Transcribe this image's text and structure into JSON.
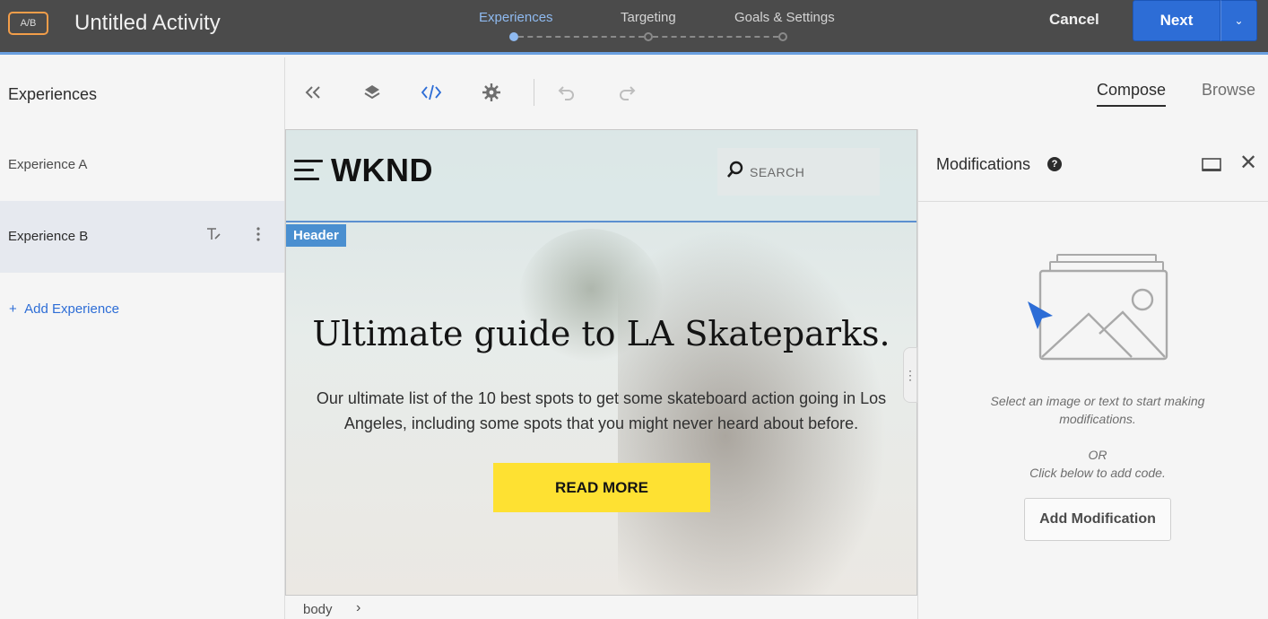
{
  "app": {
    "badge": "A/B",
    "title": "Untitled Activity"
  },
  "steps": [
    {
      "label": "Experiences"
    },
    {
      "label": "Targeting"
    },
    {
      "label": "Goals & Settings"
    }
  ],
  "actions": {
    "cancel": "Cancel",
    "next": "Next",
    "next_menu_icon": "chevron-down-icon"
  },
  "sidebar": {
    "title": "Experiences",
    "items": [
      {
        "label": "Experience A"
      },
      {
        "label": "Experience B"
      }
    ],
    "add_label": "Add Experience"
  },
  "toolbar": {
    "icons": [
      "collapse-icon",
      "layers-icon",
      "code-icon",
      "gear-icon",
      "undo-icon",
      "redo-icon"
    ],
    "tabs": {
      "compose": "Compose",
      "browse": "Browse"
    }
  },
  "site": {
    "brand": "WKND",
    "search_placeholder": "SEARCH",
    "header_tag": "Header",
    "hero_title": "Ultimate guide to LA Skateparks.",
    "hero_text": "Our ultimate list of the 10 best spots to get some skateboard action going in Los Angeles, including some spots that you might never heard about before.",
    "cta": "READ MORE"
  },
  "panel": {
    "title": "Modifications",
    "message": "Select an image or text to start making modifications.",
    "or": "OR",
    "or_hint": "Click below to add code.",
    "add_button": "Add Modification"
  },
  "footer": {
    "crumb": "body"
  },
  "colors": {
    "accent": "#2d6dd6",
    "topbar": "#4b4b4b",
    "badge": "#f29d49",
    "cta": "#fee132",
    "header_tag": "#4a8fd0"
  }
}
